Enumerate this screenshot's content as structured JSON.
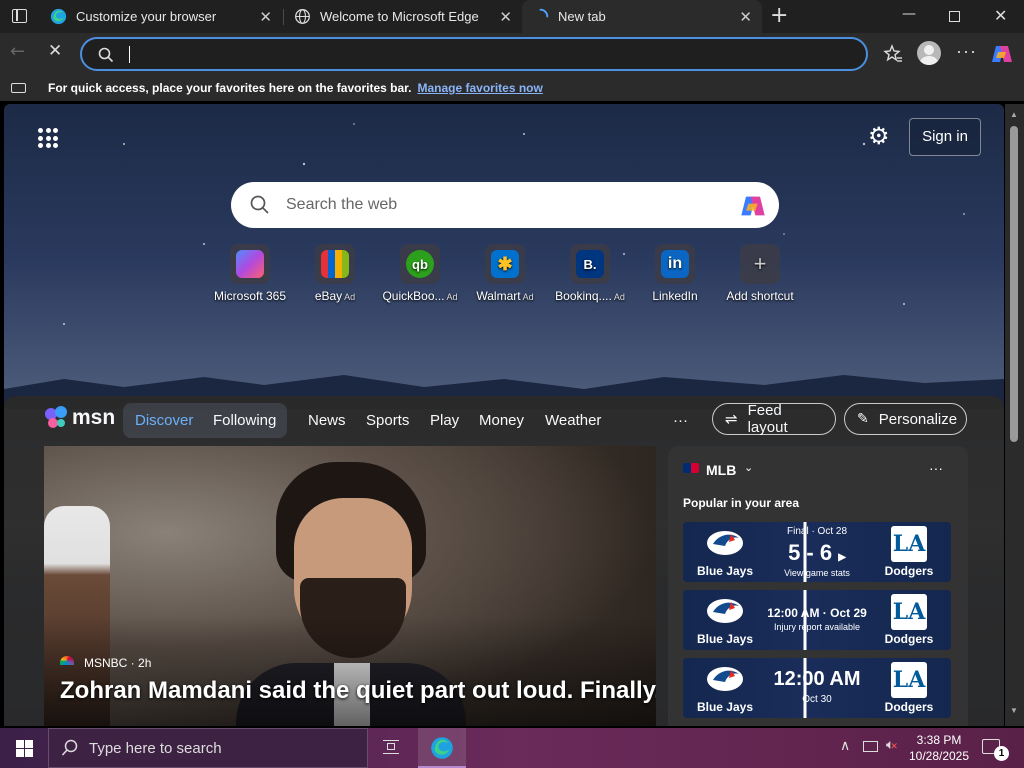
{
  "tabs": [
    {
      "title": "Customize your browser"
    },
    {
      "title": "Welcome to Microsoft Edge"
    },
    {
      "title": "New tab"
    }
  ],
  "address_bar": {
    "value": "",
    "placeholder": ""
  },
  "favorites_bar": {
    "message": "For quick access, place your favorites here on the favorites bar.",
    "link": "Manage favorites now"
  },
  "newtab": {
    "sign_in": "Sign in",
    "search_placeholder": "Search the web",
    "shortcuts": [
      {
        "label": "Microsoft 365",
        "ad": ""
      },
      {
        "label": "eBay",
        "ad": "Ad"
      },
      {
        "label": "QuickBoo...",
        "ad": "Ad"
      },
      {
        "label": "Walmart",
        "ad": "Ad"
      },
      {
        "label": "Bookinq....",
        "ad": "Ad"
      },
      {
        "label": "LinkedIn",
        "ad": ""
      },
      {
        "label": "Add shortcut",
        "ad": ""
      }
    ]
  },
  "msn": {
    "brand": "msn",
    "tabs": [
      "Discover",
      "Following"
    ],
    "nav": [
      "News",
      "Sports",
      "Play",
      "Money",
      "Weather"
    ],
    "more": "···",
    "feed_layout": "Feed layout",
    "personalize": "Personalize",
    "hero": {
      "source": "MSNBC",
      "age": "2h",
      "headline": "Zohran Mamdani said the quiet part out loud. Finally."
    }
  },
  "mlb": {
    "title": "MLB",
    "subtitle": "Popular in your area",
    "more": "···",
    "games": [
      {
        "home": "Blue Jays",
        "away": "Dodgers",
        "status": "Final · Oct 28",
        "main": "5 - 6",
        "sub": "View game stats"
      },
      {
        "home": "Blue Jays",
        "away": "Dodgers",
        "status": "12:00 AM · Oct 29",
        "main": "",
        "sub": "Injury report available"
      },
      {
        "home": "Blue Jays",
        "away": "Dodgers",
        "status": "",
        "main": "12:00 AM",
        "sub": "Oct 30"
      }
    ]
  },
  "taskbar": {
    "search_placeholder": "Type here to search",
    "time": "3:38 PM",
    "date": "10/28/2025",
    "notification_count": "1"
  }
}
